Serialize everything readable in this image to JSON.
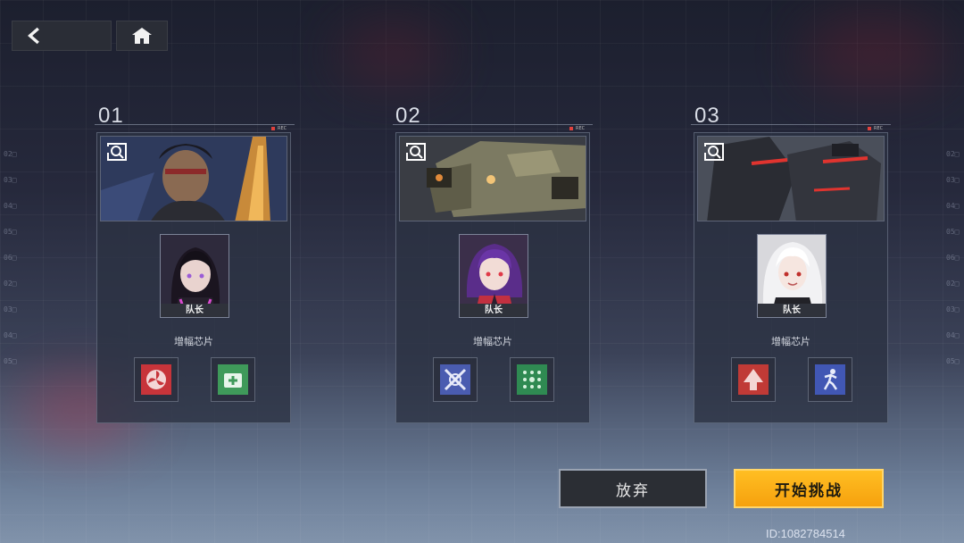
{
  "nav": {
    "back_icon": "back-arrow-icon",
    "home_icon": "home-icon"
  },
  "cards": [
    {
      "number": "01",
      "rec": "REC",
      "leader_label": "队长",
      "chip_label": "增幅芯片",
      "chips": [
        {
          "icon": "fan-blade-chip-icon",
          "color": "#c7343a"
        },
        {
          "icon": "medkit-chip-icon",
          "color": "#3f9a5a"
        }
      ]
    },
    {
      "number": "02",
      "rec": "REC",
      "leader_label": "队长",
      "chip_label": "增幅芯片",
      "chips": [
        {
          "icon": "crossed-swords-chip-icon",
          "color": "#4a5cb0"
        },
        {
          "icon": "dot-grid-chip-icon",
          "color": "#2f8a52"
        }
      ]
    },
    {
      "number": "03",
      "rec": "REC",
      "leader_label": "队长",
      "chip_label": "增幅芯片",
      "chips": [
        {
          "icon": "arrow-up-chip-icon",
          "color": "#c03a36"
        },
        {
          "icon": "runner-chip-icon",
          "color": "#4157b4"
        }
      ]
    }
  ],
  "buttons": {
    "abandon": "放弃",
    "start": "开始挑战"
  },
  "uid": "ID:1082784514",
  "side_numbers": [
    "02□",
    "03□",
    "04□",
    "05□",
    "06□",
    "02□",
    "03□",
    "04□",
    "05□"
  ],
  "colors": {
    "accent": "#f6a10d",
    "card_border": "#aab4c8"
  }
}
